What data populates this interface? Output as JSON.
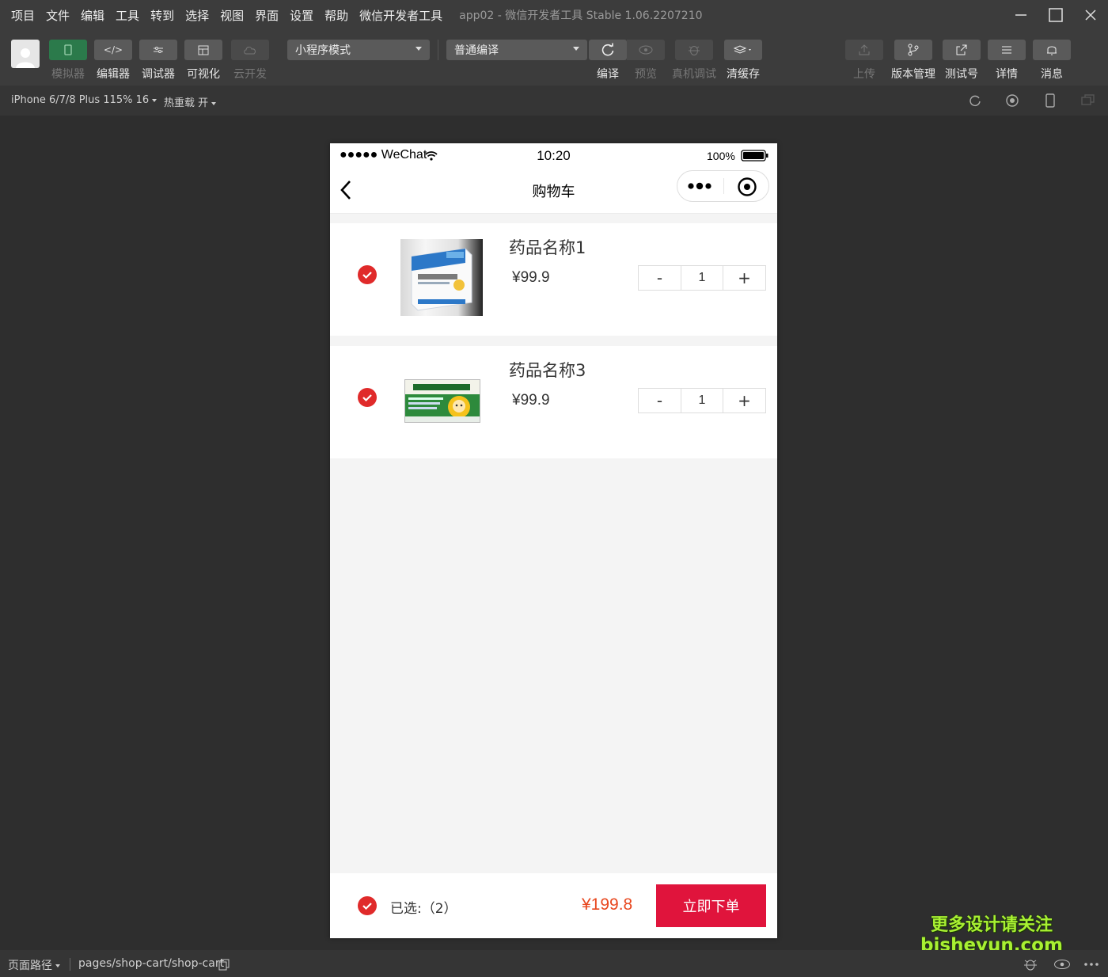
{
  "menubar": {
    "items": [
      "项目",
      "文件",
      "编辑",
      "工具",
      "转到",
      "选择",
      "视图",
      "界面",
      "设置",
      "帮助",
      "微信开发者工具"
    ],
    "window_title": "app02 - 微信开发者工具 Stable 1.06.2207210"
  },
  "toolbar": {
    "view_buttons": [
      {
        "label": "模拟器",
        "icon": "phone-icon",
        "active": true
      },
      {
        "label": "编辑器",
        "icon": "code-icon",
        "active": false
      },
      {
        "label": "调试器",
        "icon": "sliders-icon",
        "active": false
      },
      {
        "label": "可视化",
        "icon": "layout-icon",
        "active": false
      },
      {
        "label": "云开发",
        "icon": "cloud-icon",
        "active": false
      }
    ],
    "mode_select": "小程序模式",
    "compile_select": "普通编译",
    "actions": [
      {
        "label": "编译",
        "icon": "refresh-icon"
      },
      {
        "label": "预览",
        "icon": "eye-icon"
      },
      {
        "label": "真机调试",
        "icon": "bug-icon"
      },
      {
        "label": "清缓存",
        "icon": "layers-icon"
      }
    ],
    "right_actions": [
      {
        "label": "上传",
        "icon": "upload-icon"
      },
      {
        "label": "版本管理",
        "icon": "branch-icon"
      },
      {
        "label": "测试号",
        "icon": "external-link-icon"
      },
      {
        "label": "详情",
        "icon": "menu-icon"
      },
      {
        "label": "消息",
        "icon": "bell-icon"
      }
    ]
  },
  "subbar": {
    "device": "iPhone 6/7/8 Plus 115% 16",
    "hot_reload": "热重载 开"
  },
  "phone": {
    "status": {
      "carrier": "●●●●● WeChat",
      "time": "10:20",
      "battery": "100%"
    },
    "nav_title": "购物车",
    "items": [
      {
        "name": "药品名称1",
        "price": "¥99.9",
        "qty": "1",
        "minus": "-",
        "plus": "+"
      },
      {
        "name": "药品名称3",
        "price": "¥99.9",
        "qty": "1",
        "minus": "-",
        "plus": "+"
      }
    ],
    "footer": {
      "selected": "已选:（2）",
      "total": "¥199.8",
      "order_button": "立即下单"
    }
  },
  "bottombar": {
    "path_label": "页面路径",
    "path": "pages/shop-cart/shop-cart"
  },
  "watermark": {
    "line1": "更多设计请关注",
    "line2": "bisheyun.com"
  },
  "colors": {
    "accent_red": "#e0143c",
    "price_red": "#e8471e",
    "check_red": "#e02a2a",
    "sim_active": "#2b7a4b"
  }
}
